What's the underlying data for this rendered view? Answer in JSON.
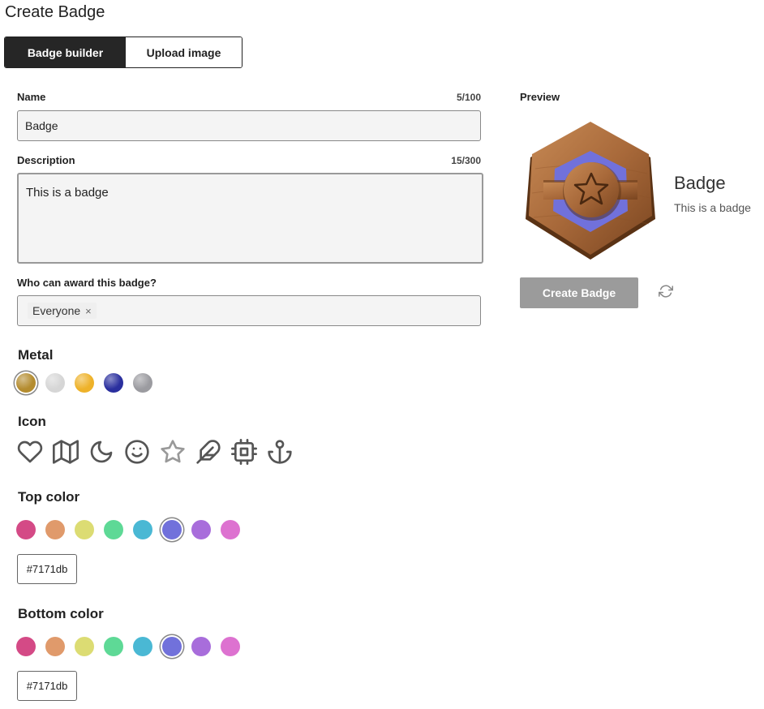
{
  "page": {
    "title": "Create Badge"
  },
  "tabs": [
    {
      "label": "Badge builder",
      "active": true
    },
    {
      "label": "Upload image",
      "active": false
    }
  ],
  "form": {
    "name": {
      "label": "Name",
      "counter": "5/100",
      "value": "Badge"
    },
    "description": {
      "label": "Description",
      "counter": "15/300",
      "value": "This is a badge"
    },
    "award": {
      "label": "Who can award this badge?",
      "chips": [
        "Everyone"
      ],
      "remove_glyph": "×"
    }
  },
  "metal": {
    "title": "Metal",
    "options": [
      {
        "name": "bronze",
        "color": "#b48c2f",
        "selected": true
      },
      {
        "name": "silver",
        "color": "#d6d6d6",
        "selected": false
      },
      {
        "name": "gold",
        "color": "#eeb22a",
        "selected": false
      },
      {
        "name": "blue",
        "color": "#2a2f9e",
        "selected": false
      },
      {
        "name": "gray",
        "color": "#9b9ba0",
        "selected": false
      }
    ]
  },
  "icon_section": {
    "title": "Icon",
    "icons": [
      "heart-icon",
      "map-icon",
      "moon-icon",
      "smile-icon",
      "star-icon",
      "feather-icon",
      "chip-icon",
      "anchor-icon"
    ],
    "selected": "star-icon"
  },
  "top_color": {
    "title": "Top color",
    "value": "#7171db",
    "swatches": [
      "#d44a86",
      "#e09a6b",
      "#dcdc73",
      "#5ed996",
      "#4ab8d4",
      "#7171db",
      "#a86ddb",
      "#dd72d0"
    ]
  },
  "bottom_color": {
    "title": "Bottom color",
    "value": "#7171db",
    "swatches": [
      "#d44a86",
      "#e09a6b",
      "#dcdc73",
      "#5ed996",
      "#4ab8d4",
      "#7171db",
      "#a86ddb",
      "#dd72d0"
    ]
  },
  "preview": {
    "label": "Preview",
    "badge_name": "Badge",
    "badge_description": "This is a badge",
    "create_button": "Create Badge"
  }
}
